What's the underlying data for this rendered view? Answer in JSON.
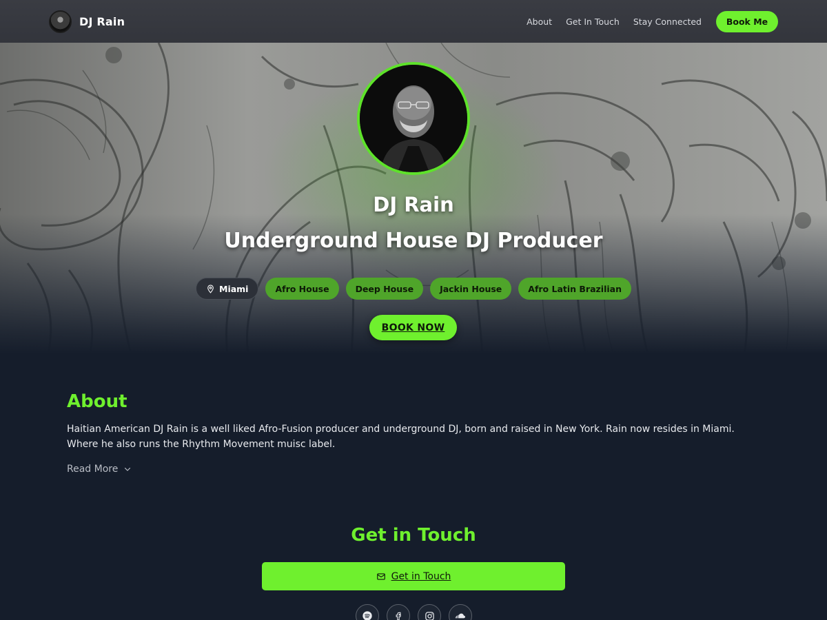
{
  "header": {
    "brand_name": "DJ Rain",
    "nav": [
      "About",
      "Get In Touch",
      "Stay Connected"
    ],
    "book_me_label": "Book Me"
  },
  "hero": {
    "name": "DJ Rain",
    "subtitle": "Underground House DJ Producer",
    "location": "Miami",
    "genres": [
      "Afro House",
      "Deep House",
      "Jackin House",
      "Afro Latin Brazilian"
    ],
    "book_now_label": "BOOK NOW"
  },
  "about": {
    "heading": "About",
    "text": "Haitian American DJ Rain is a well liked Afro-Fusion producer and underground DJ, born and raised in New York. Rain now resides in Miami. Where he also runs the Rhythm Movement muisc label.",
    "read_more_label": "Read More"
  },
  "get_in_touch": {
    "heading": "Get in Touch",
    "button_label": "Get in Touch"
  },
  "socials": [
    "spotify-icon",
    "facebook-icon",
    "instagram-icon",
    "soundcloud-icon"
  ],
  "colors": {
    "accent": "#6ff02e",
    "genre_tag": "#4fa52a",
    "page_bg": "#151d2b",
    "header_bg": "#3a3c43"
  }
}
